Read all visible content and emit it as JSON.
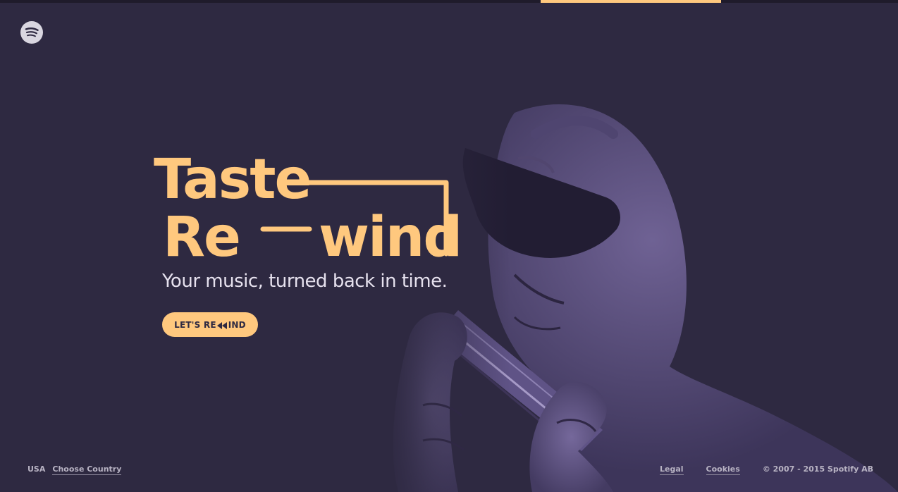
{
  "colors": {
    "background": "#2e2941",
    "accent": "#ffc87e",
    "footer_text": "#b8b3c3",
    "tagline_text": "#e6e1ee"
  },
  "branding": {
    "logo_icon": "spotify-logo-icon"
  },
  "hero": {
    "title_line_1": "Taste",
    "title_line_2_start": "Re",
    "title_line_2_end": "wind",
    "tagline": "Your music, turned back in time.",
    "cta_prefix": "LET'S RE",
    "cta_icon": "rewind-icon",
    "cta_suffix": "IND"
  },
  "footer": {
    "country": "USA",
    "choose_country": "Choose Country",
    "legal": "Legal",
    "cookies": "Cookies",
    "copyright": "© 2007 - 2015 Spotify AB"
  }
}
